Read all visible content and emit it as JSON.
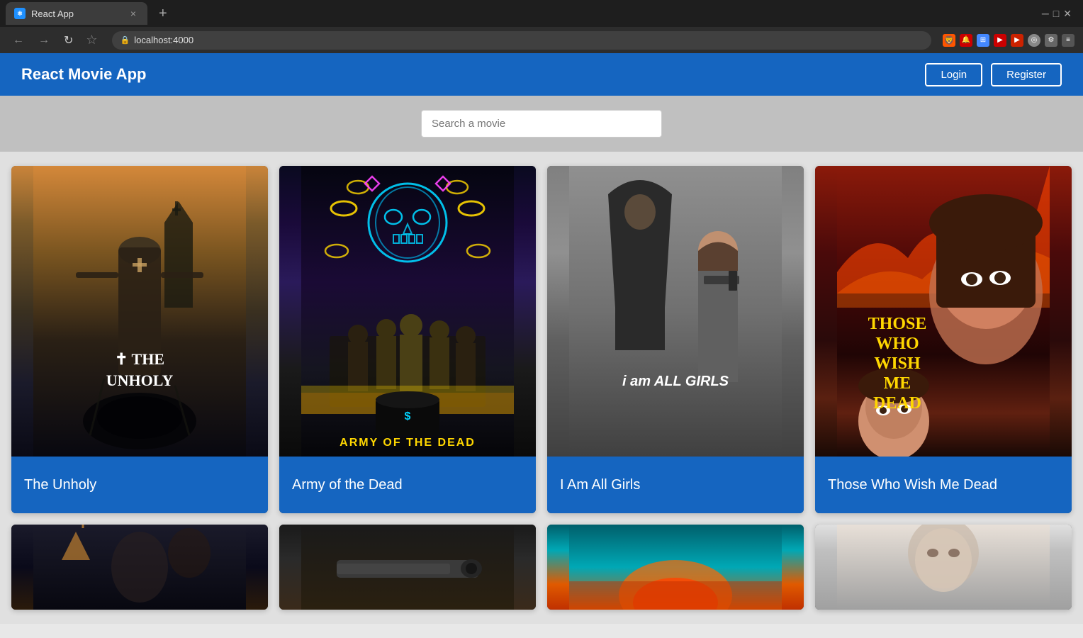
{
  "browser": {
    "tab_title": "React App",
    "tab_favicon": "R",
    "url": "localhost:4000",
    "new_tab_label": "+"
  },
  "app": {
    "title": "React Movie App",
    "login_label": "Login",
    "register_label": "Register"
  },
  "search": {
    "placeholder": "Search a movie"
  },
  "movies_row1": [
    {
      "id": "unholy",
      "title": "The Unholy",
      "poster_class": "poster-unholy"
    },
    {
      "id": "army",
      "title": "Army of the Dead",
      "poster_class": "poster-army"
    },
    {
      "id": "girls",
      "title": "I Am All Girls",
      "poster_class": "poster-girls"
    },
    {
      "id": "those",
      "title": "Those Who Wish Me Dead",
      "poster_class": "poster-those"
    }
  ],
  "movies_row2": [
    {
      "id": "row2-1",
      "title": "",
      "poster_class": "poster-row2-1"
    },
    {
      "id": "row2-2",
      "title": "",
      "poster_class": "poster-row2-2"
    },
    {
      "id": "row2-3",
      "title": "",
      "poster_class": "poster-row2-3"
    },
    {
      "id": "row2-4",
      "title": "",
      "poster_class": "poster-row2-4"
    }
  ],
  "icons": {
    "lock": "🔒",
    "back": "←",
    "forward": "→",
    "reload": "↻"
  }
}
